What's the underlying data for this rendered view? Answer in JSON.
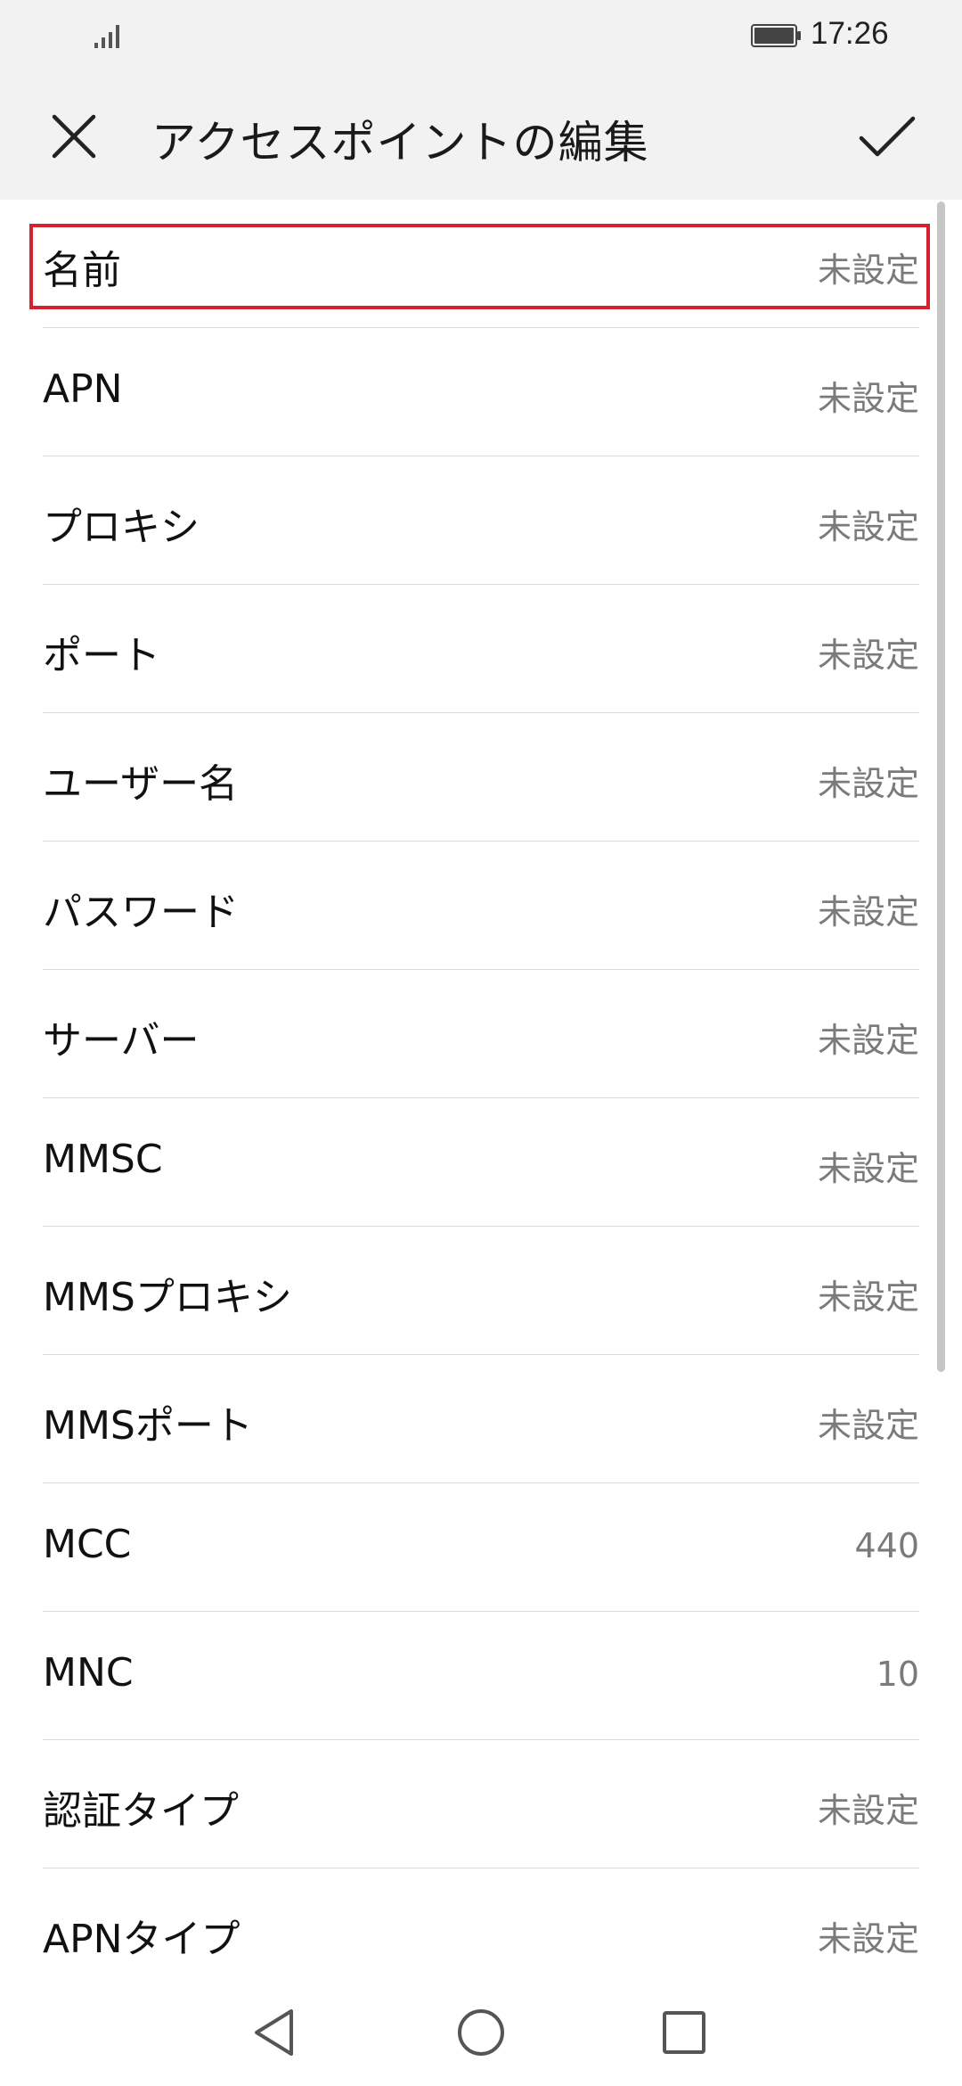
{
  "status_bar": {
    "time": "17:26"
  },
  "toolbar": {
    "title": "アクセスポイントの編集"
  },
  "rows": [
    {
      "label": "名前",
      "value": "未設定"
    },
    {
      "label": "APN",
      "value": "未設定"
    },
    {
      "label": "プロキシ",
      "value": "未設定"
    },
    {
      "label": "ポート",
      "value": "未設定"
    },
    {
      "label": "ユーザー名",
      "value": "未設定"
    },
    {
      "label": "パスワード",
      "value": "未設定"
    },
    {
      "label": "サーバー",
      "value": "未設定"
    },
    {
      "label": "MMSC",
      "value": "未設定"
    },
    {
      "label": "MMSプロキシ",
      "value": "未設定"
    },
    {
      "label": "MMSポート",
      "value": "未設定"
    },
    {
      "label": "MCC",
      "value": "440"
    },
    {
      "label": "MNC",
      "value": "10"
    },
    {
      "label": "認証タイプ",
      "value": "未設定"
    },
    {
      "label": "APNタイプ",
      "value": "未設定"
    }
  ],
  "colors": {
    "highlight": "#d4232e",
    "header_bg": "#f2f2f2"
  },
  "icons": {
    "close": "close-icon",
    "confirm": "check-icon",
    "back": "nav-back-icon",
    "home": "nav-home-icon",
    "recents": "nav-recents-icon"
  }
}
